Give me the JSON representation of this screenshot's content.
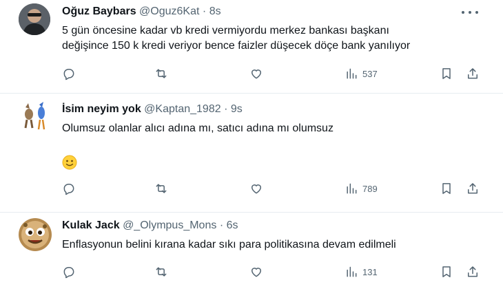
{
  "tweets": [
    {
      "name": "Oğuz Baybars",
      "handle": "@Oguz6Kat",
      "separator": "·",
      "time": "8s",
      "text_line1": "5 gün öncesine kadar vb kredi vermiyordu merkez bankası başkanı",
      "text_line2": "değişince 150 k kredi veriyor bence faizler düşecek döçe bank yanılıyor",
      "views": "537"
    },
    {
      "name": "İsim neyim yok",
      "handle": "@Kaptan_1982",
      "separator": "·",
      "time": "9s",
      "text_line1": "Olumsuz olanlar alıcı adına mı, satıcı adına mı olumsuz",
      "emoji": "slightly-smiling-face",
      "views": "789"
    },
    {
      "name": "Kulak Jack",
      "handle": "@_Olympus_Mons",
      "separator": "·",
      "time": "6s",
      "text_line1": "Enflasyonun belini kırana kadar sıkı para politikasına devam edilmeli",
      "views": "131"
    }
  ],
  "colors": {
    "text": "#0f1419",
    "muted": "#536471",
    "divider": "#e6ecf0"
  }
}
